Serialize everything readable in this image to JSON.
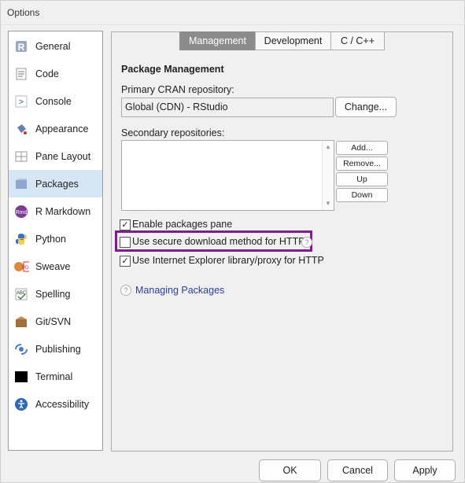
{
  "window": {
    "title": "Options"
  },
  "sidebar": {
    "items": [
      {
        "label": "General",
        "icon": "r-logo-icon"
      },
      {
        "label": "Code",
        "icon": "code-document-icon"
      },
      {
        "label": "Console",
        "icon": "console-prompt-icon"
      },
      {
        "label": "Appearance",
        "icon": "paint-bucket-icon"
      },
      {
        "label": "Pane Layout",
        "icon": "pane-layout-icon"
      },
      {
        "label": "Packages",
        "icon": "package-box-icon"
      },
      {
        "label": "R Markdown",
        "icon": "rmd-icon"
      },
      {
        "label": "Python",
        "icon": "python-icon"
      },
      {
        "label": "Sweave",
        "icon": "sweave-icon"
      },
      {
        "label": "Spelling",
        "icon": "spelling-icon"
      },
      {
        "label": "Git/SVN",
        "icon": "git-box-icon"
      },
      {
        "label": "Publishing",
        "icon": "publishing-icon"
      },
      {
        "label": "Terminal",
        "icon": "terminal-icon"
      },
      {
        "label": "Accessibility",
        "icon": "accessibility-icon"
      }
    ],
    "selected": "Packages"
  },
  "tabs": [
    {
      "label": "Management",
      "active": true
    },
    {
      "label": "Development",
      "active": false
    },
    {
      "label": "C / C++",
      "active": false
    }
  ],
  "management": {
    "section_title": "Package Management",
    "primary_label": "Primary CRAN repository:",
    "primary_value": "Global (CDN) - RStudio",
    "change_button": "Change...",
    "secondary_label": "Secondary repositories:",
    "add_button": "Add...",
    "remove_button": "Remove...",
    "up_button": "Up",
    "down_button": "Down",
    "options": [
      {
        "label": "Enable packages pane",
        "checked": true
      },
      {
        "label": "Use secure download method for HTTP",
        "checked": false
      },
      {
        "label": "Use Internet Explorer library/proxy for HTTP",
        "checked": true
      }
    ],
    "help_link": "Managing Packages"
  },
  "footer": {
    "ok": "OK",
    "cancel": "Cancel",
    "apply": "Apply"
  },
  "colors": {
    "highlight": "#7b1f8a",
    "selected_bg": "#d6e6f5",
    "link": "#2a3f9e"
  }
}
